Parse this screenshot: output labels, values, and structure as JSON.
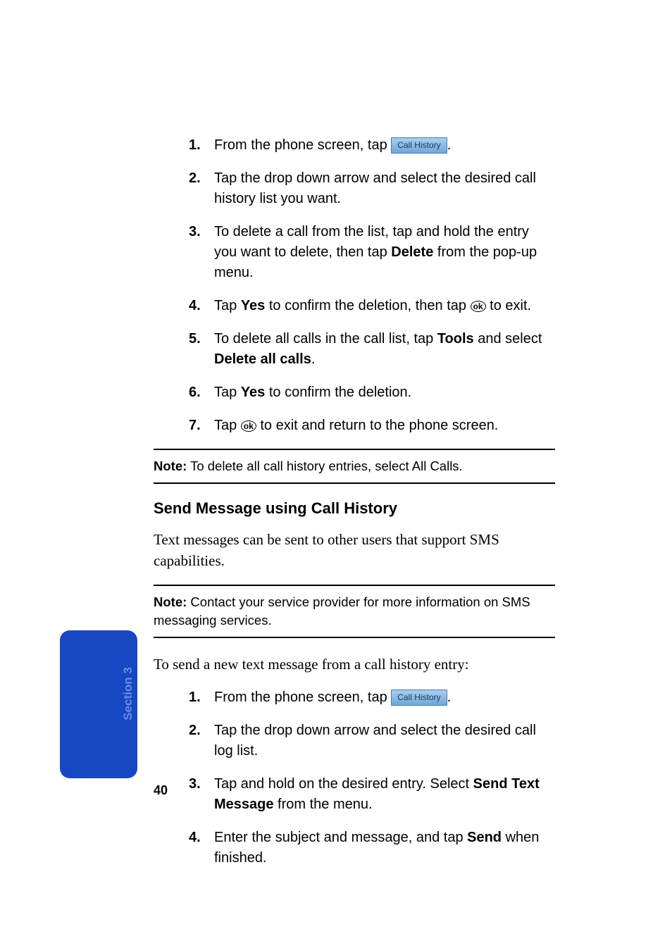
{
  "steps1": [
    {
      "num": "1.",
      "pre": "From the phone screen, tap ",
      "icon": "call-history",
      "post": "."
    },
    {
      "num": "2.",
      "text": "Tap the drop down arrow and select the desired call history list you want."
    },
    {
      "num": "3.",
      "pre": "To delete a call from the list, tap and hold the entry you want to delete, then tap ",
      "bold": "Delete",
      "post": " from the pop-up menu."
    },
    {
      "num": "4.",
      "parts": [
        "Tap ",
        {
          "bold": "Yes"
        },
        " to confirm the deletion, then tap ",
        {
          "ok": true
        },
        " to exit."
      ]
    },
    {
      "num": "5.",
      "parts": [
        "To delete all calls in the call list, tap ",
        {
          "bold": "Tools"
        },
        " and select ",
        {
          "bold": "Delete all calls"
        },
        "."
      ]
    },
    {
      "num": "6.",
      "parts": [
        "Tap ",
        {
          "bold": "Yes"
        },
        " to confirm the deletion."
      ]
    },
    {
      "num": "7.",
      "parts": [
        "Tap ",
        {
          "ok": true
        },
        " to exit and return to the phone screen."
      ]
    }
  ],
  "note1": {
    "label": "Note:",
    "text": " To delete all call history entries, select All Calls."
  },
  "heading": "Send Message using Call History",
  "body1": "Text messages can be sent to other users that support SMS capabilities.",
  "note2": {
    "label": "Note:",
    "text": " Contact your service provider for more information on SMS messaging services."
  },
  "body2": "To send a new text message from a call history entry:",
  "steps2": [
    {
      "num": "1.",
      "pre": "From the phone screen, tap ",
      "icon": "call-history",
      "post": "."
    },
    {
      "num": "2.",
      "text": "Tap the drop down arrow and select the desired call log list."
    },
    {
      "num": "3.",
      "parts": [
        "Tap and hold on the desired entry. Select ",
        {
          "bold": "Send Text Message"
        },
        " from the menu."
      ]
    },
    {
      "num": "4.",
      "parts": [
        "Enter the subject and message, and tap ",
        {
          "bold": "Send"
        },
        " when finished."
      ]
    }
  ],
  "callHistoryLabel": "Call History",
  "okLabel": "ok",
  "sectionTab": "Section 3",
  "pageNum": "40"
}
